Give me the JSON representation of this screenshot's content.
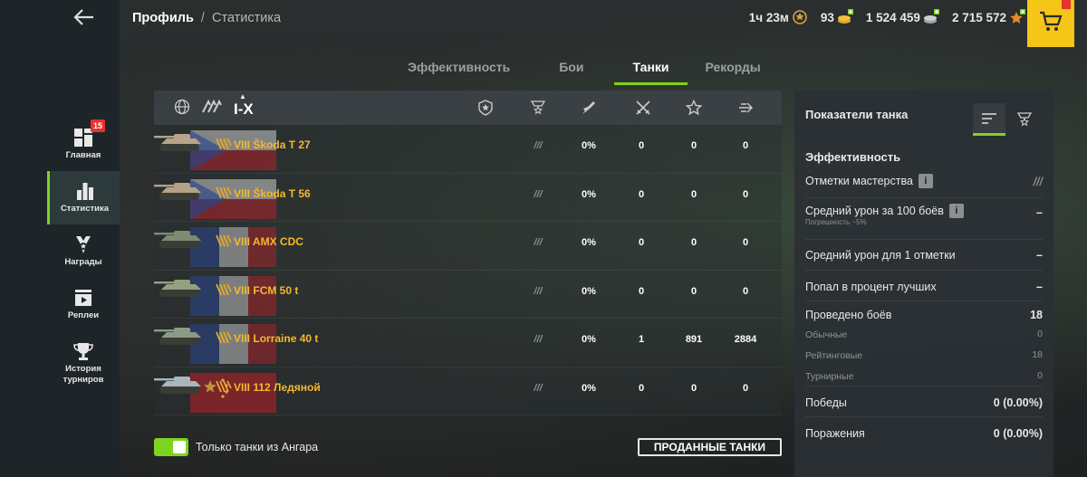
{
  "header": {
    "breadcrumb_root": "Профиль",
    "breadcrumb_sep": "/",
    "breadcrumb_current": "Статистика"
  },
  "currencies": {
    "premium_time": "1ч 23м",
    "gold": "93",
    "credits": "1 524 459",
    "free_xp": "2 715 572"
  },
  "sidebar": {
    "items": [
      {
        "label": "Главная",
        "icon": "home-icon",
        "badge": "15"
      },
      {
        "label": "Статистика",
        "icon": "stats-icon"
      },
      {
        "label": "Награды",
        "icon": "awards-icon"
      },
      {
        "label": "Реплеи",
        "icon": "replay-icon"
      },
      {
        "label": "История турниров",
        "icon": "trophy-icon"
      }
    ]
  },
  "tabs": [
    {
      "label": "Эффективность"
    },
    {
      "label": "Бои"
    },
    {
      "label": "Танки"
    },
    {
      "label": "Рекорды"
    }
  ],
  "table": {
    "tier_filter": "I-X",
    "rows": [
      {
        "tier": "VIII",
        "name": "Škoda T 27",
        "nation": "czech",
        "mark": "///",
        "pct": "0%",
        "c1": "0",
        "c2": "0",
        "c3": "0"
      },
      {
        "tier": "VIII",
        "name": "Škoda T 56",
        "nation": "czech",
        "mark": "///",
        "pct": "0%",
        "c1": "0",
        "c2": "0",
        "c3": "0"
      },
      {
        "tier": "VIII",
        "name": "AMX CDC",
        "nation": "france",
        "mark": "///",
        "pct": "0%",
        "c1": "0",
        "c2": "0",
        "c3": "0"
      },
      {
        "tier": "VIII",
        "name": "FCM 50 t",
        "nation": "france",
        "mark": "///",
        "pct": "0%",
        "c1": "0",
        "c2": "0",
        "c3": "0"
      },
      {
        "tier": "VIII",
        "name": "Lorraine 40 t",
        "nation": "france",
        "mark": "///",
        "pct": "0%",
        "c1": "1",
        "c2": "891",
        "c3": "2884"
      },
      {
        "tier": "VIII",
        "name": "112 Ледяной",
        "nation": "china",
        "mark": "///",
        "pct": "0%",
        "c1": "0",
        "c2": "0",
        "c3": "0"
      }
    ]
  },
  "bottom": {
    "toggle_label": "Только танки из Ангара",
    "sold_button": "ПРОДАННЫЕ ТАНКИ"
  },
  "panel": {
    "title": "Показатели танка",
    "section": "Эффективность",
    "mastery_label": "Отметки мастерства",
    "mastery_value": "///",
    "avg_dmg_label": "Средний урон за 100 боёв",
    "avg_dmg_note": "Погрешность ~5%",
    "avg_dmg_value": "–",
    "avg_dmg_mark_label": "Средний урон для 1 отметки",
    "avg_dmg_mark_value": "–",
    "top_pct_label": "Попал в процент лучших",
    "top_pct_value": "–",
    "battles_label": "Проведено боёв",
    "battles_value": "18",
    "regular_label": "Обычные",
    "regular_value": "0",
    "rating_label": "Рейтинговые",
    "rating_value": "18",
    "tourn_label": "Турнирные",
    "tourn_value": "0",
    "wins_label": "Победы",
    "wins_value": "0 (0.00%)",
    "losses_label": "Поражения",
    "losses_value": "0 (0.00%)"
  }
}
